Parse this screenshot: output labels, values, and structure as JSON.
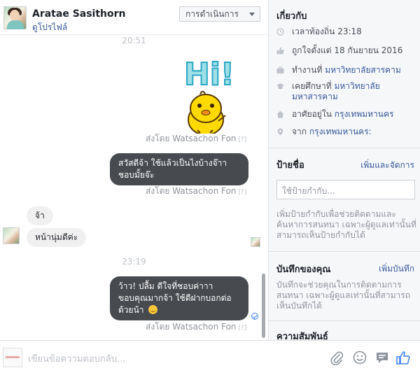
{
  "header": {
    "name": "Aratae Sasithorn",
    "profile_link": "ดูโปรไฟล์",
    "actions_label": "การดำเนินการ"
  },
  "conversation": {
    "timestamp_1": "20:51",
    "timestamp_2": "23:19",
    "sent_by_1": "ส่งโดย Watsachon Fon",
    "sent_by_2": "ส่งโดย Watsachon Fon",
    "sent_by_3": "ส่งโดย Watsachon Fon",
    "question_mark": "[?]",
    "sticker_text": "Hi!",
    "msg_out_1_line1": "สวัสดีจ้า ใช้แล้วเป็นไงบ้างจ๊าา",
    "msg_out_1_line2": "ชอบมั้ยจ๊ะ",
    "msg_in_1": "จ้า",
    "msg_in_2": "หน้านุ่มดีค่ะ",
    "msg_out_2_line1": "ว้าว! ปลื้ม ดีใจที่ชอบค่าาา",
    "msg_out_2_line2": "ขอบคุณมากจ้า ใช้ดีฝากบอกต่อ",
    "msg_out_2_line3": "ด้วยน้า"
  },
  "composer": {
    "placeholder": "เขียนข้อความตอบกลับ..."
  },
  "sidebar": {
    "about_title": "เกี่ยวกับ",
    "local_time_prefix": "เวลาท้องถิ่น",
    "local_time": "23:18",
    "liked_page": "ถูกใจตั้งแต่ 18 กันยายน 2016",
    "works_prefix": "ทำงานที่",
    "works_at": "มหาวิทยาลัยสารคาม",
    "studied_prefix": "เคยศึกษาที่",
    "studied_at": "มหาวิทยาลัยมหาสารคาม",
    "lives_prefix": "อาศัยอยู่ใน",
    "lives_in": "กรุงเทพมหานคร",
    "from_prefix": "จาก",
    "from": "กรุงเทพมหานคร:",
    "labels_title": "ป้ายชื่อ",
    "labels_link": "เพิ่มและจัดการ",
    "tag_placeholder": "ใช้ป้ายกำกับ...",
    "labels_help": "เพิ่มป้ายกำกับเพื่อช่วยติดตามและค้นหาการสนทนา เฉพาะผู้ดูแลเท่านั้นที่สามารถเห็นป้ายกำกับได้",
    "notes_title": "บันทึกของคุณ",
    "notes_link": "เพิ่มบันทึก",
    "notes_help": "บันทึกจะช่วยคุณในการติดตามการสนทนา เฉพาะผู้ดูแลเท่านั้นที่สามารถเห็นบันทึกได้",
    "relationship_title": "ความสัมพันธ์"
  },
  "colors": {
    "outgoing_bubble": "#474a4f",
    "incoming_bubble": "#f1f0f0",
    "link": "#365899",
    "like_blue": "#4080ff"
  }
}
